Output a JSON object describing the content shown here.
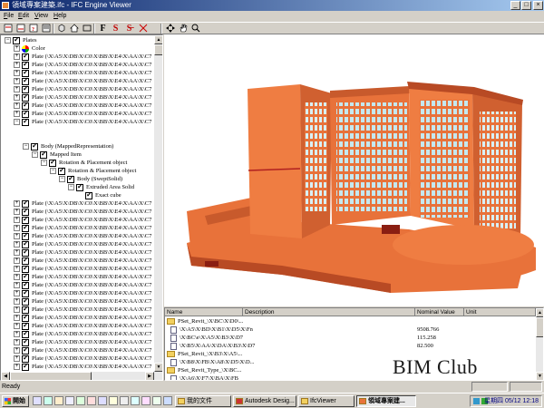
{
  "window": {
    "title": "領域專案建築.ifc - IFC Engine Viewer",
    "controls": [
      "_",
      "□",
      "×"
    ]
  },
  "menu": [
    "File",
    "Edit",
    "View",
    "Help"
  ],
  "toolbar": {
    "letters": [
      "F",
      "S",
      "S̶"
    ]
  },
  "tree": {
    "root": "Plates",
    "color": "Color",
    "plate_label": "Plate (\\X\\A5\\X\\DB\\X\\C0\\X\\BB\\X\\E4\\X\\AA\\X\\C7",
    "body": "Body (MappedRepresentation)",
    "mapped_item": "Mapped Item",
    "rot1": "Rotation & Placement object",
    "rot2": "Rotation & Placement object",
    "body_swept": "Body (SweptSolid)",
    "extruded": "Extruded Area Solid",
    "exact": "Exact cube"
  },
  "properties": {
    "headers": [
      "Name",
      "Description",
      "Nominal Value",
      "Unit"
    ],
    "rows": [
      {
        "kind": "folder",
        "name": "PSet_Revit_\\X\\BC\\X\\D0\\...",
        "description": "",
        "value": "",
        "unit": ""
      },
      {
        "kind": "doc",
        "name": "\\X\\A5\\X\\BD\\X\\B1\\X\\D5\\X\\Fn",
        "description": "",
        "value": "9508.766",
        "unit": ""
      },
      {
        "kind": "doc",
        "name": "\\X\\BC\\e\\X\\A5\\X\\B3\\X\\D7",
        "description": "",
        "value": "115.258",
        "unit": ""
      },
      {
        "kind": "doc",
        "name": "\\X\\B5\\X\\AA\\X\\DA\\X\\B3\\X\\D7",
        "description": "",
        "value": "82.500",
        "unit": ""
      },
      {
        "kind": "folder",
        "name": "PSet_Revit_\\X\\B3\\X\\A5\\...",
        "description": "",
        "value": "",
        "unit": ""
      },
      {
        "kind": "doc",
        "name": "\\X\\B8\\X\\FB\\X\\A8\\X\\D5\\X\\D...",
        "description": "",
        "value": "",
        "unit": ""
      },
      {
        "kind": "folder",
        "name": "PSet_Revit_Type_\\X\\BC...",
        "description": "",
        "value": "",
        "unit": ""
      },
      {
        "kind": "doc",
        "name": "\\X\\A6\\X\\F7\\X\\BA\\X\\FB",
        "description": "",
        "value": "",
        "unit": ""
      }
    ]
  },
  "watermark": "BIM Club",
  "status": {
    "text": "Ready"
  },
  "taskbar": {
    "start": "開始",
    "tasks": [
      "我的文件",
      "Autodesk Desig...",
      "IfcViewer",
      "領域專案建..."
    ],
    "clock": "星期四 05/12 12:18"
  },
  "colors": {
    "building": "#e8723a",
    "building_dark": "#b84a24",
    "glass": "#c4e8f0",
    "titlebar": "#0a246a"
  }
}
